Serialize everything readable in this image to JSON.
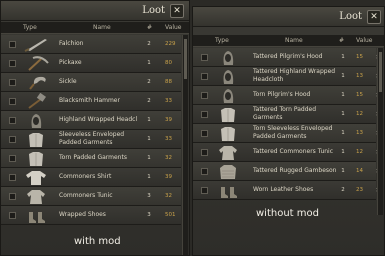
{
  "left": {
    "title": "Loot",
    "close_label": "✕",
    "headers": {
      "type": "Type",
      "name": "Name",
      "count": "#",
      "value": "Value"
    },
    "items": [
      {
        "icon": "falchion-icon",
        "name": "Falchion",
        "count": "2",
        "value": "229"
      },
      {
        "icon": "pickaxe-icon",
        "name": "Pickaxe",
        "count": "1",
        "value": "80"
      },
      {
        "icon": "sickle-icon",
        "name": "Sickle",
        "count": "2",
        "value": "88"
      },
      {
        "icon": "hammer-icon",
        "name": "Blacksmith Hammer",
        "count": "2",
        "value": "33"
      },
      {
        "icon": "hood-icon",
        "name": "Highland Wrapped Headcloth",
        "count": "1",
        "value": "39"
      },
      {
        "icon": "garment-icon",
        "name": "Sleeveless Enveloped Padded Garments",
        "count": "1",
        "value": "33"
      },
      {
        "icon": "garment-icon",
        "name": "Torn Padded Garments",
        "count": "1",
        "value": "32"
      },
      {
        "icon": "shirt-icon",
        "name": "Commoners Shirt",
        "count": "1",
        "value": "39"
      },
      {
        "icon": "tunic-icon",
        "name": "Commoners Tunic",
        "count": "3",
        "value": "32"
      },
      {
        "icon": "shoes-icon",
        "name": "Wrapped Shoes",
        "count": "3",
        "value": "501"
      }
    ]
  },
  "right": {
    "title": "Loot",
    "close_label": "✕",
    "headers": {
      "type": "Type",
      "name": "Name",
      "count": "#",
      "value": "Value"
    },
    "items": [
      {
        "icon": "hood-icon",
        "name": "Tattered Pilgrim's Hood",
        "count": "1",
        "value": "15"
      },
      {
        "icon": "hood-icon",
        "name": "Tattered Highland Wrapped Headcloth",
        "count": "1",
        "value": "13"
      },
      {
        "icon": "hood-icon",
        "name": "Torn Pilgrim's Hood",
        "count": "1",
        "value": "15"
      },
      {
        "icon": "garment-icon",
        "name": "Tattered Torn Padded Garments",
        "count": "1",
        "value": "12"
      },
      {
        "icon": "garment-icon",
        "name": "Torn Sleeveless Enveloped Padded Garments",
        "count": "1",
        "value": "13"
      },
      {
        "icon": "tunic-icon",
        "name": "Tattered Commoners Tunic",
        "count": "1",
        "value": "12"
      },
      {
        "icon": "gambeson-icon",
        "name": "Tattered Rugged Gambeson",
        "count": "1",
        "value": "14"
      },
      {
        "icon": "shoes-icon",
        "name": "Worn Leather Shoes",
        "count": "2",
        "value": "23"
      }
    ]
  },
  "captions": {
    "left": "with mod",
    "right": "without mod"
  },
  "colors": {
    "value": "#c9a24a",
    "panel": "#34332e",
    "text": "#ddd7c6"
  }
}
